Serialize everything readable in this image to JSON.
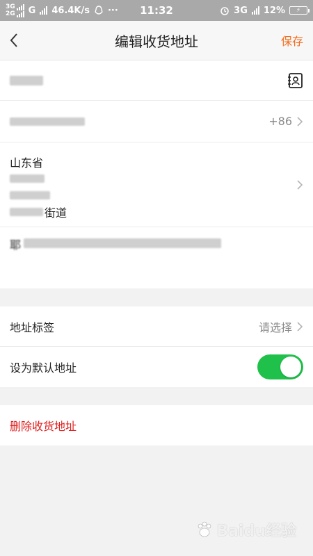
{
  "status_bar": {
    "net_top": "3G",
    "net_bottom": "2G",
    "net_g": "G",
    "speed": "46.4K/s",
    "dots": "···",
    "time": "11:32",
    "net_right": "3G",
    "battery": "12%"
  },
  "nav": {
    "title": "编辑收货地址",
    "save_label": "保存"
  },
  "form": {
    "phone_prefix": "+86",
    "region_province": "山东省",
    "region_street_suffix": "街道",
    "detail_prefix": "耶"
  },
  "settings": {
    "tag_label": "地址标签",
    "tag_value": "请选择",
    "default_label": "设为默认地址",
    "default_on": true
  },
  "actions": {
    "delete_label": "删除收货地址"
  },
  "watermark": {
    "text": "Baidu经验"
  },
  "colors": {
    "accent": "#f36d1e",
    "toggle_on": "#1fc14a",
    "danger": "#e01d1d"
  }
}
